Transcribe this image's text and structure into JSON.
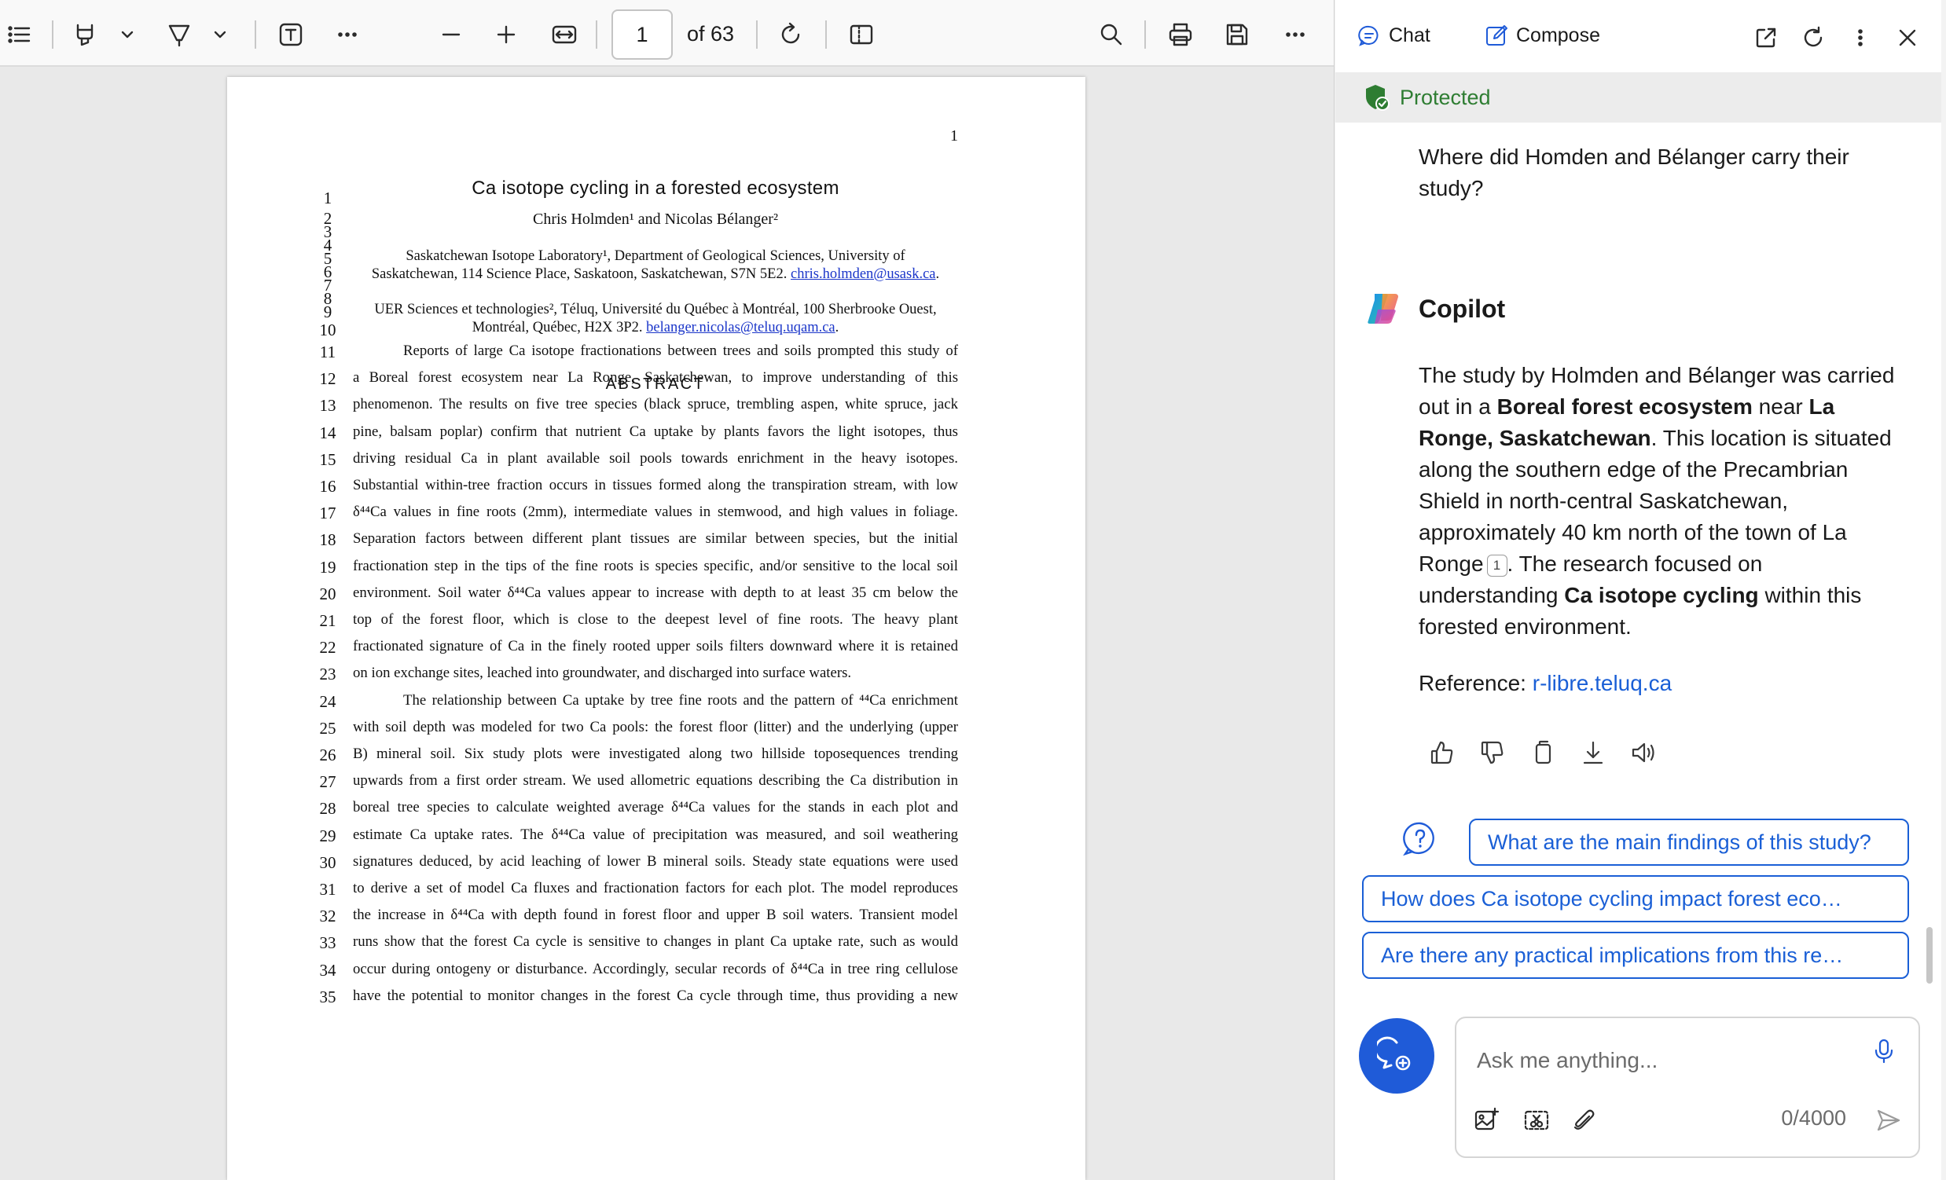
{
  "pdf_toolbar": {
    "page_input_value": "1",
    "page_count_label": "of 63",
    "icons": [
      "contents-icon",
      "highlight-icon",
      "draw-icon",
      "text-icon",
      "more-tools-icon",
      "zoom-out-icon",
      "zoom-in-icon",
      "fit-width-icon",
      "rotate-icon",
      "page-view-icon",
      "search-icon",
      "print-icon",
      "save-icon",
      "more-options-icon"
    ]
  },
  "document": {
    "page_number": "1",
    "title": "Ca isotope cycling in a forested ecosystem",
    "authors": "Chris Holmden¹ and Nicolas Bélanger²",
    "affiliation1_line1": "Saskatchewan Isotope Laboratory¹, Department of Geological Sciences, University of",
    "affiliation1_line2_text": "Saskatchewan, 114 Science Place, Saskatoon, Saskatchewan, S7N 5E2. ",
    "affiliation1_email": "chris.holmden@usask.ca",
    "affiliation2_line1": "UER Sciences et technologies², Téluq, Université du Québec à Montréal, 100 Sherbrooke Ouest,",
    "affiliation2_line2_text": "Montréal, Québec, H2X 3P2. ",
    "affiliation2_email": "belanger.nicolas@teluq.uqam.ca",
    "abstract_heading": "ABSTRACT",
    "line_numbers": [
      "1",
      "2",
      "3",
      "4",
      "5",
      "6",
      "7",
      "8",
      "9",
      "10",
      "11",
      "12",
      "13",
      "14",
      "15",
      "16",
      "17",
      "18",
      "19",
      "20",
      "21",
      "22",
      "23",
      "24",
      "25",
      "26",
      "27",
      "28",
      "29",
      "30",
      "31",
      "32",
      "33",
      "34",
      "35"
    ],
    "abstract_lines": [
      "Reports of large Ca isotope fractionations between trees and soils prompted this study of",
      "a Boreal forest ecosystem near La Ronge, Saskatchewan, to improve understanding of this",
      "phenomenon. The results on five tree species (black spruce, trembling aspen, white spruce, jack",
      "pine, balsam poplar) confirm that nutrient Ca uptake by plants favors the light isotopes, thus",
      "driving residual Ca in plant available soil pools towards enrichment in the heavy isotopes.",
      "Substantial within-tree fraction occurs in tissues formed along the transpiration stream, with low",
      "δ⁴⁴Ca values in fine roots (2mm), intermediate values in stemwood, and high values in foliage.",
      "Separation factors between different plant tissues are similar between species, but the initial",
      "fractionation step in the tips of the fine roots is species specific, and/or sensitive to the local soil",
      "environment. Soil water δ⁴⁴Ca values appear to increase with depth to at least 35 cm below the",
      "top of the forest floor, which is close to the deepest level of fine roots. The heavy plant",
      "fractionated signature of Ca in the finely rooted upper soils filters downward where it is retained",
      "on ion exchange sites, leached into groundwater, and discharged into surface waters.",
      "The relationship between Ca uptake by tree fine roots and the pattern of ⁴⁴Ca enrichment",
      "with soil depth was modeled for two Ca pools: the forest floor (litter) and the underlying (upper",
      "B) mineral soil. Six study plots were investigated along two hillside toposequences trending",
      "upwards from a first order stream. We used allometric equations describing the Ca distribution in",
      "boreal tree species to calculate weighted average δ⁴⁴Ca values for the stands in each plot and",
      "estimate Ca uptake rates. The δ⁴⁴Ca value of precipitation was measured, and soil weathering",
      "signatures deduced, by acid leaching of lower B mineral soils. Steady state equations were used",
      "to derive a set of model Ca fluxes and fractionation factors for each plot. The model reproduces",
      "the increase in δ⁴⁴Ca with depth found in forest floor and upper B soil waters. Transient model",
      "runs show that the forest Ca cycle is sensitive to changes in plant Ca uptake rate, such as would",
      "occur during ontogeny or disturbance. Accordingly, secular records of δ⁴⁴Ca in tree ring cellulose",
      "have the potential to monitor changes in the forest Ca cycle through time, thus providing a new"
    ]
  },
  "copilot": {
    "tab_chat": "Chat",
    "tab_compose": "Compose",
    "protected_label": "Protected",
    "user_question": "Where did Homden and Bélanger carry their study?",
    "assistant_name": "Copilot",
    "answer": {
      "p1": "The study by Holmden and Bélanger was carried out in a ",
      "b1": "Boreal forest ecosystem",
      "p2": " near ",
      "b2": "La Ronge, Saskatchewan",
      "p3": ". This location is situated along the southern edge of the Precambrian Shield in north-central Saskatchewan, approximately 40 km north of the town of La Ronge",
      "citation": "1",
      "p4": ". The research focused on understanding ",
      "b3": "Ca isotope cycling",
      "p5": " within this forested environment."
    },
    "reference_label": "Reference: ",
    "reference_link": "r-libre.teluq.ca",
    "suggestions": [
      "What are the main findings of this study?",
      "How does Ca isotope cycling impact forest eco…",
      "Are there any practical implications from this re…"
    ],
    "composer_placeholder": "Ask me anything...",
    "char_count": "0/4000",
    "colors": {
      "accent": "#1f5bd8",
      "protected_green": "#2e7d32",
      "link_blue": "#1a5fd6"
    }
  }
}
